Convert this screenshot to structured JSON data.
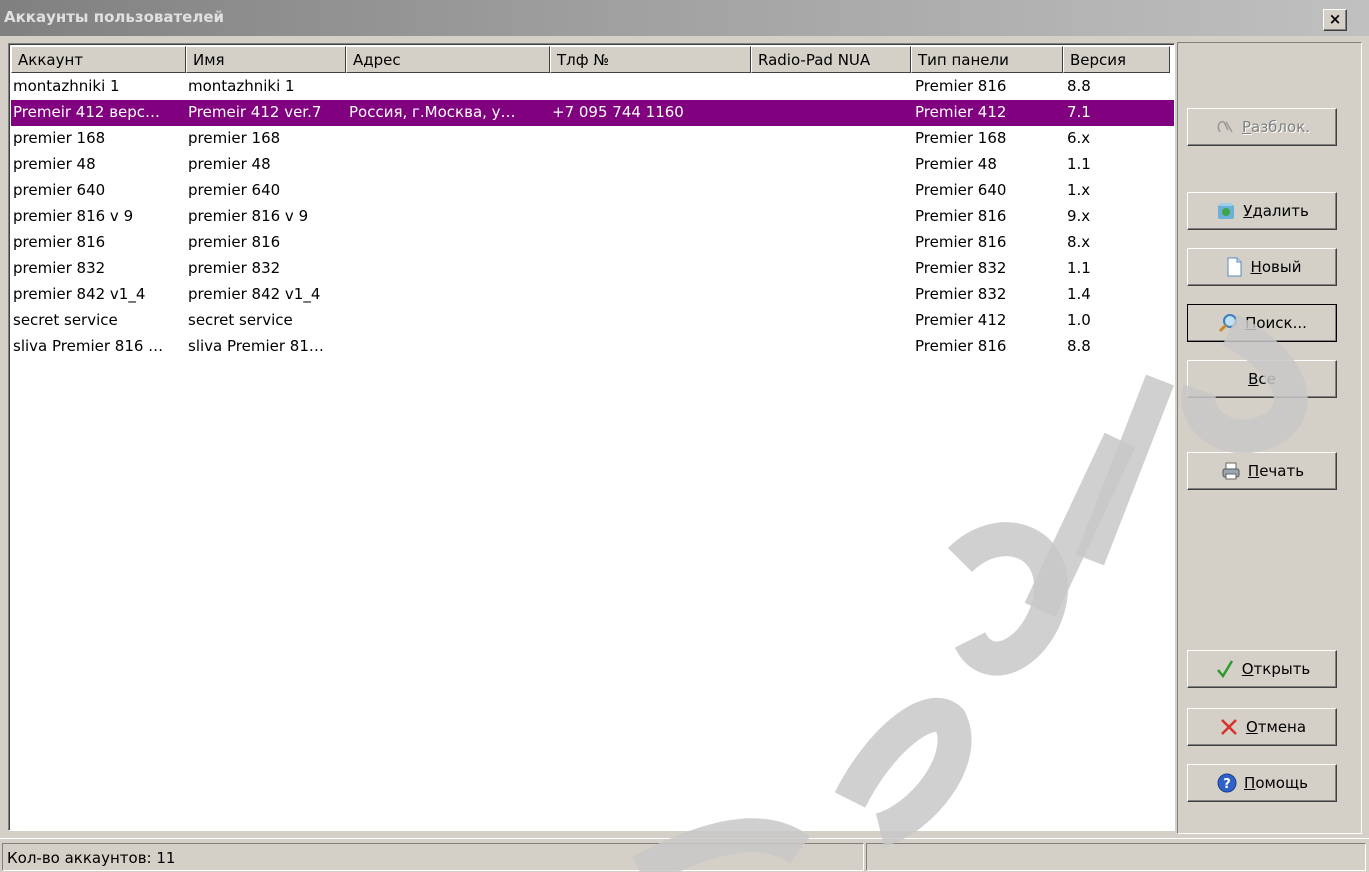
{
  "window": {
    "title": "Аккаунты пользователей",
    "close_label": "×"
  },
  "table": {
    "columns": [
      "Аккаунт",
      "Имя",
      "Адрес",
      "Тлф №",
      "Radio-Pad NUA",
      "Тип панели",
      "Версия"
    ],
    "rows": [
      [
        "montazhniki 1",
        "montazhniki 1",
        "",
        "",
        "",
        "Premier 816",
        "8.8"
      ],
      [
        "Premeir 412 верс…",
        "Premeir 412 ver.7",
        "Россия, г.Москва, у…",
        "+7 095 744 1160",
        "",
        "Premier 412",
        "7.1"
      ],
      [
        "premier 168",
        "premier 168",
        "",
        "",
        "",
        "Premier 168",
        "6.x"
      ],
      [
        "premier 48",
        "premier 48",
        "",
        "",
        "",
        "Premier 48",
        "1.1"
      ],
      [
        "premier 640",
        "premier 640",
        "",
        "",
        "",
        "Premier 640",
        "1.x"
      ],
      [
        "premier 816 v 9",
        "premier 816 v 9",
        "",
        "",
        "",
        "Premier 816",
        "9.x"
      ],
      [
        "premier 816",
        "premier 816",
        "",
        "",
        "",
        "Premier 816",
        "8.x"
      ],
      [
        "premier 832",
        "premier 832",
        "",
        "",
        "",
        "Premier 832",
        "1.1"
      ],
      [
        "premier 842 v1_4",
        "premier 842 v1_4",
        "",
        "",
        "",
        "Premier 832",
        "1.4"
      ],
      [
        "secret service",
        "secret service",
        "",
        "",
        "",
        "Premier 412",
        "1.0"
      ],
      [
        "sliva Premier 816 …",
        "sliva Premier 81…",
        "",
        "",
        "",
        "Premier 816",
        "8.8"
      ]
    ],
    "selected_index": 1
  },
  "buttons": {
    "unlock": "Разблок.",
    "delete": "Удалить",
    "new": "Новый",
    "search": "Поиск...",
    "all": "Все",
    "print": "Печать",
    "open": "Открыть",
    "cancel": "Отмена",
    "help": "Помощь"
  },
  "status": {
    "text": "Кол-во аккаунтов: 11"
  },
  "colors": {
    "selection": "#800080",
    "watermark": "#c0c0c0"
  },
  "icons": [
    "unlock-icon",
    "recycle-icon",
    "new-document-icon",
    "magnifier-icon",
    "printer-icon",
    "checkmark-icon",
    "x-mark-icon",
    "help-icon"
  ]
}
